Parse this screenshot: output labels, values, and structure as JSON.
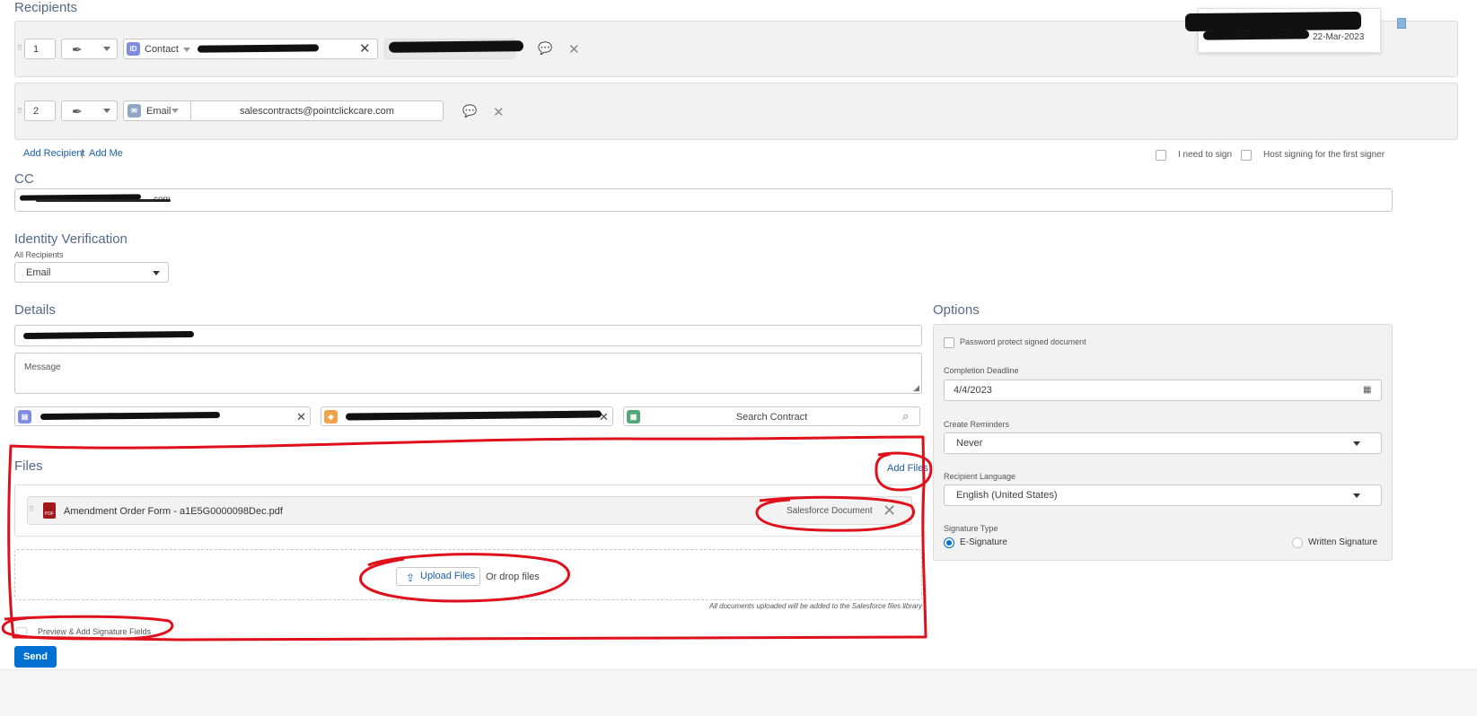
{
  "recipients": {
    "title": "Recipients",
    "rows": [
      {
        "order": "1",
        "type_label": "Contact",
        "type_icon": "contact-icon"
      },
      {
        "order": "2",
        "type_label": "Email",
        "type_icon": "email-icon",
        "value": "salescontracts@pointclickcare.com"
      }
    ],
    "add_recipient": "Add Recipient",
    "separator": "|",
    "add_me": "Add Me",
    "i_need_to_sign": "I need to sign",
    "host_signing": "Host signing for the first signer",
    "popup_time": "22-Mar-2023"
  },
  "cc": {
    "title": "CC",
    "value_suffix": "com"
  },
  "identity": {
    "title": "Identity Verification",
    "sublabel": "All Recipients",
    "selected": "Email"
  },
  "details": {
    "title": "Details",
    "message_placeholder": "Message",
    "search_contract_placeholder": "Search Contract"
  },
  "files": {
    "title": "Files",
    "add_files": "Add Files",
    "file_name": "Amendment Order Form - a1E5G0000098Dec.pdf",
    "file_source": "Salesforce Document",
    "upload_label": "Upload Files",
    "drop_label": "Or drop files",
    "library_note": "All documents uploaded will be added to the Salesforce files library"
  },
  "preview": {
    "label": "Preview & Add Signature Fields"
  },
  "send": {
    "label": "Send"
  },
  "options": {
    "title": "Options",
    "password_protect": "Password protect signed document",
    "deadline_label": "Completion Deadline",
    "deadline_value": "4/4/2023",
    "reminders_label": "Create Reminders",
    "reminders_value": "Never",
    "language_label": "Recipient Language",
    "language_value": "English (United States)",
    "signature_type_label": "Signature Type",
    "esignature": "E-Signature",
    "written_signature": "Written Signature"
  },
  "colors": {
    "brand": "#0070d2",
    "link": "#1a5fa8",
    "annotation": "#e0101a",
    "panel": "#f3f2f2"
  }
}
